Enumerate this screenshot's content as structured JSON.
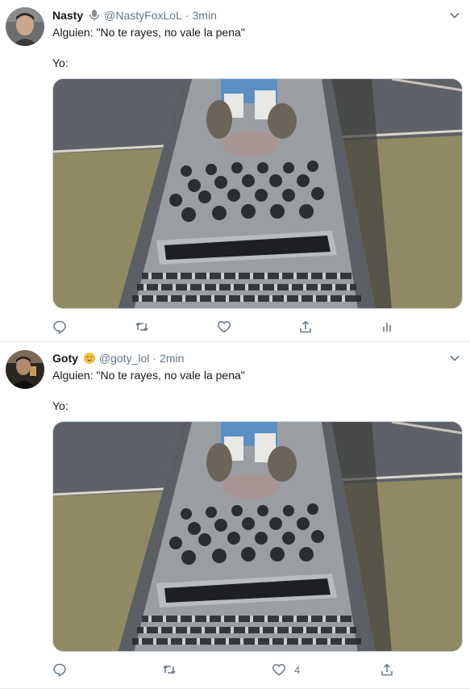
{
  "tweets": [
    {
      "name": "Nasty",
      "badge_icon": "microphone-icon",
      "handle": "@NastyFoxLoL",
      "separator": "·",
      "time": "3min",
      "line1": "Alguien: \"No te rayes, no vale la pena\"",
      "line2": "Yo:",
      "actions": {
        "reply_count": "",
        "retweet_count": "",
        "like_count": "",
        "share_count": ""
      },
      "has_analytics": true
    },
    {
      "name": "Goty",
      "badge_icon": "smiling-face-emoji-icon",
      "handle": "@goty_lol",
      "separator": "·",
      "time": "2min",
      "line1": "Alguien: \"No te rayes, no vale la pena\"",
      "line2": "Yo:",
      "actions": {
        "reply_count": "",
        "retweet_count": "",
        "like_count": "4",
        "share_count": ""
      },
      "has_analytics": false
    }
  ],
  "colors": {
    "icon": "#657786",
    "text": "#14171a",
    "secondary": "#657786",
    "border": "#e6ecf0"
  }
}
